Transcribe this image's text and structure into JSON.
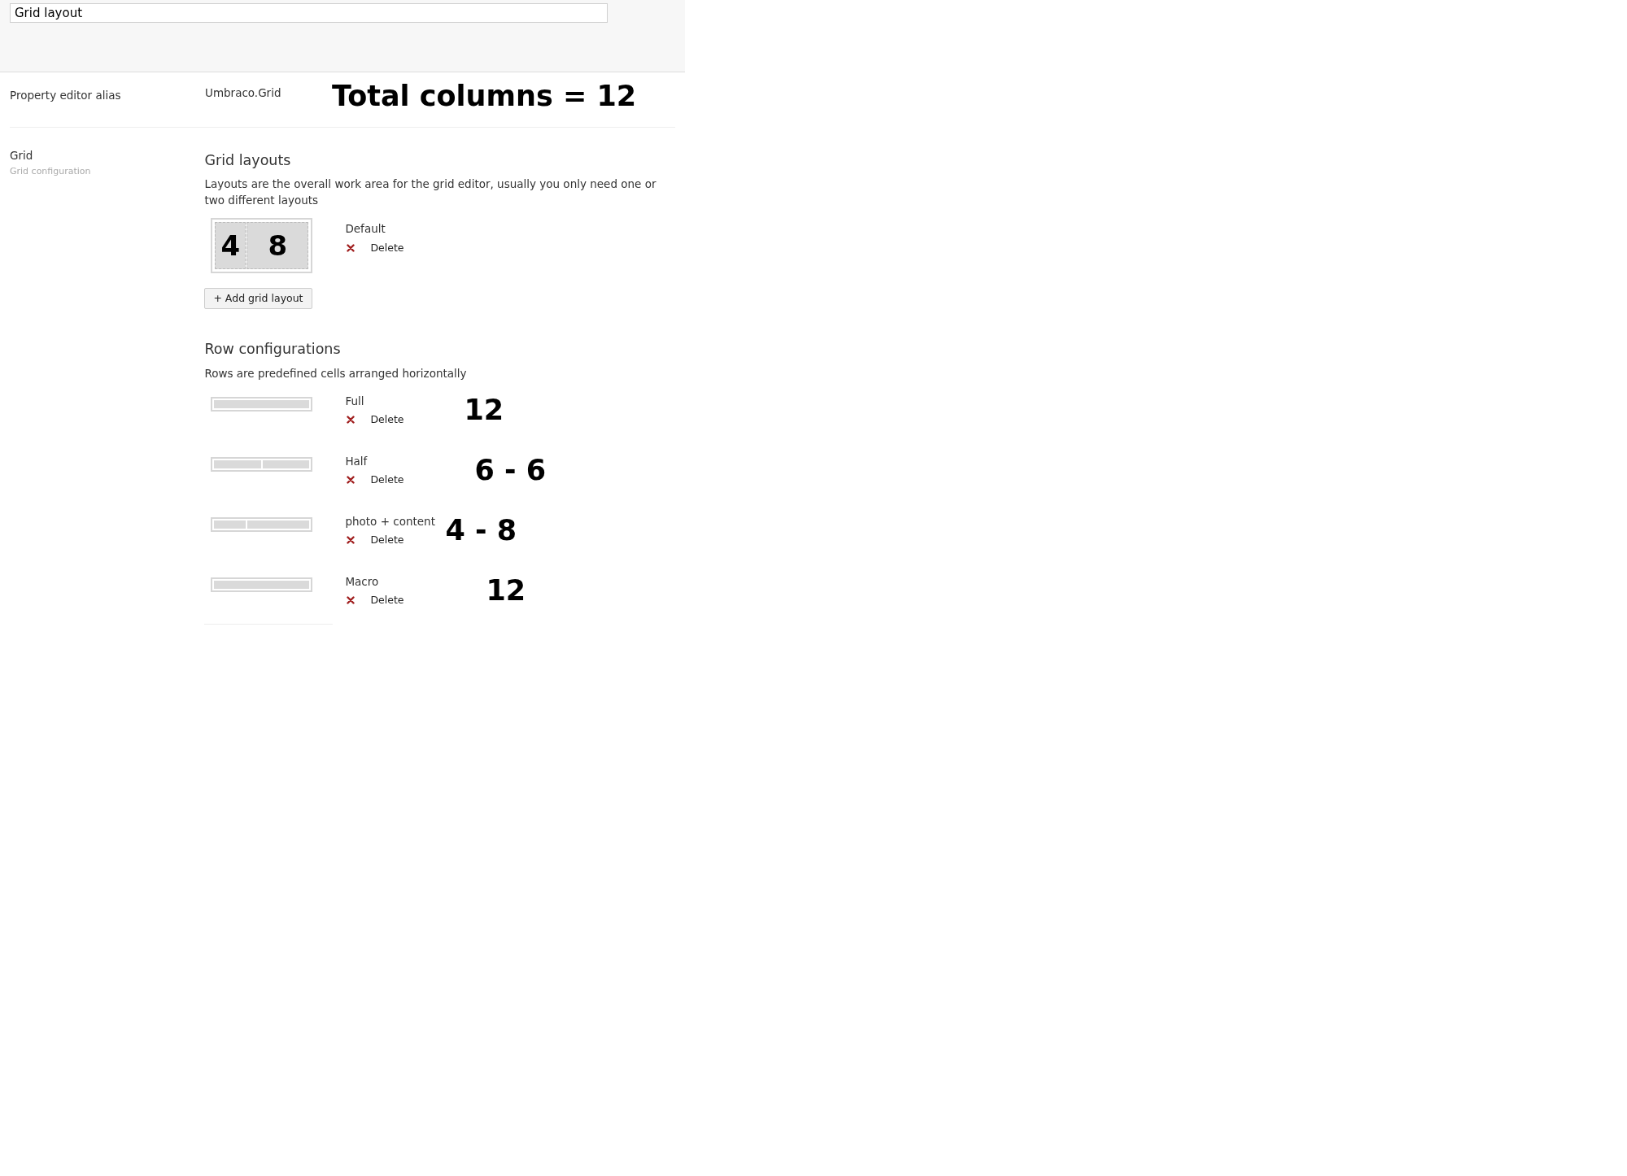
{
  "name_field": {
    "value": "Grid layout"
  },
  "alias": {
    "label": "Property editor alias",
    "value": "Umbraco.Grid",
    "annotation": "Total columns = 12"
  },
  "grid": {
    "label": "Grid",
    "description": "Grid configuration"
  },
  "grid_layouts": {
    "heading": "Grid layouts",
    "description": "Layouts are the overall work area for the grid editor, usually you only need one or two different layouts",
    "items": [
      {
        "name": "Default",
        "delete": "Delete",
        "cells": [
          {
            "label": "4",
            "level": 0.333
          },
          {
            "label": "8",
            "level": 0.667
          }
        ]
      }
    ],
    "add_button": "+ Add grid layout"
  },
  "row_configurations": {
    "heading": "Row configurations",
    "description": "Rows are predefined cells arranged horizontally",
    "items": [
      {
        "name": "Full",
        "delete": "Delete",
        "annotation": "12",
        "cells": [
          {
            "level": 1
          }
        ]
      },
      {
        "name": "Half",
        "delete": "Delete",
        "annotation": "6 - 6",
        "cells": [
          {
            "level": 0.5
          },
          {
            "level": 0.5
          }
        ]
      },
      {
        "name": "photo + content",
        "delete": "Delete",
        "annotation": "4 - 8",
        "cells": [
          {
            "level": 0.333
          },
          {
            "level": 0.667
          }
        ]
      },
      {
        "name": "Macro",
        "delete": "Delete",
        "annotation": "12",
        "cells": [
          {
            "level": 1
          }
        ]
      }
    ]
  }
}
